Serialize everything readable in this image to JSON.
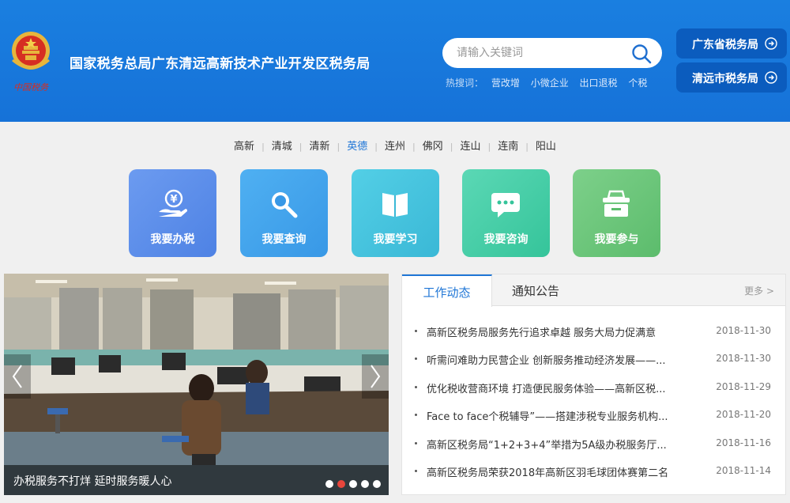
{
  "header": {
    "site_title": "国家税务总局广东清远高新技术产业开发区税务局",
    "emblem_text": "中国税务",
    "search": {
      "placeholder": "请输入关键词",
      "value": ""
    },
    "hot_search_label": "热搜词：",
    "hot_search": [
      "营改增",
      "小微企业",
      "出口退税",
      "个税"
    ],
    "region_buttons": [
      "广东省税务局",
      "清远市税务局"
    ]
  },
  "county_nav": {
    "items": [
      "高新",
      "清城",
      "清新",
      "英德",
      "连州",
      "佛冈",
      "连山",
      "连南",
      "阳山"
    ],
    "active": "英德",
    "separator": "|"
  },
  "services": [
    {
      "label": "我要办税",
      "icon": "tax-payment-icon"
    },
    {
      "label": "我要查询",
      "icon": "magnifier-icon"
    },
    {
      "label": "我要学习",
      "icon": "book-icon"
    },
    {
      "label": "我要咨询",
      "icon": "chat-bubble-icon"
    },
    {
      "label": "我要参与",
      "icon": "ballot-box-icon"
    }
  ],
  "carousel": {
    "caption": "办税服务不打烊 延时服务暖人心",
    "slide_count": 5,
    "active_index": 2
  },
  "news": {
    "tabs": [
      "工作动态",
      "通知公告"
    ],
    "active_tab": "工作动态",
    "more_label": "更多 >",
    "items": [
      {
        "title": "高新区税务局服务先行追求卓越 服务大局力促满意",
        "date": "2018-11-30"
      },
      {
        "title": "听需问难助力民营企业 创新服务推动经济发展——...",
        "date": "2018-11-30"
      },
      {
        "title": "优化税收营商环境 打造便民服务体验——高新区税...",
        "date": "2018-11-29"
      },
      {
        "title": "Face to face个税辅导”——搭建涉税专业服务机构...",
        "date": "2018-11-20"
      },
      {
        "title": "高新区税务局“1+2+3+4”举措为5A级办税服务厅...",
        "date": "2018-11-16"
      },
      {
        "title": "高新区税务局荣获2018年高新区羽毛球团体赛第二名",
        "date": "2018-11-14"
      }
    ]
  },
  "colors": {
    "header_bg": "#1a7fe0",
    "region_button_bg": "#0b5cbe",
    "accent": "#1f76d6",
    "active_dot": "#e8463c"
  }
}
